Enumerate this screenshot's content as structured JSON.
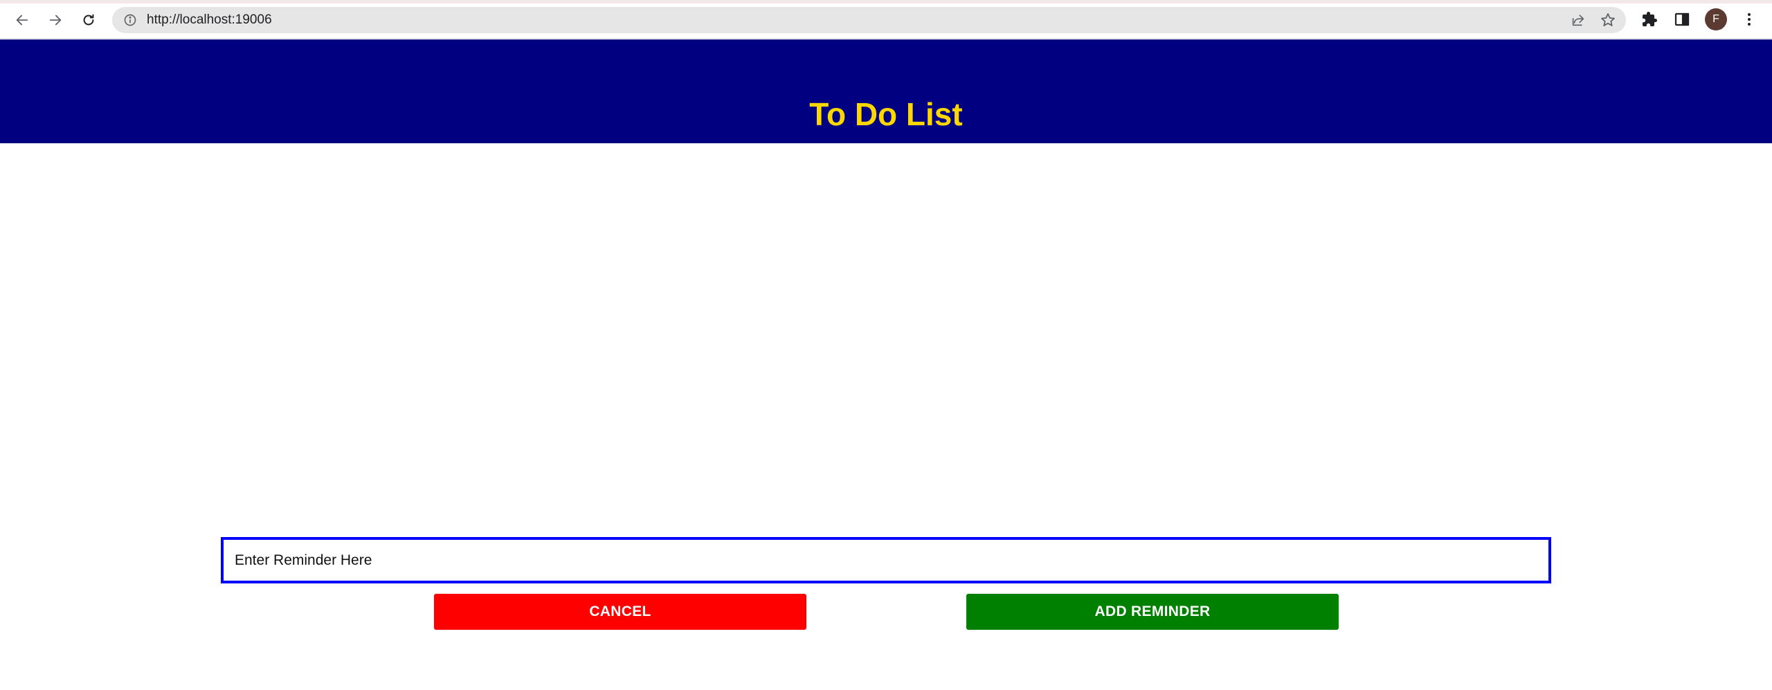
{
  "browser": {
    "url": "http://localhost:19006",
    "avatar_initial": "F",
    "icons": {
      "back": "arrow-left-icon",
      "forward": "arrow-right-icon",
      "reload": "reload-icon",
      "site_info": "info-icon",
      "share": "share-icon",
      "bookmark": "star-icon",
      "extensions": "puzzle-icon",
      "side_panel": "side-panel-icon",
      "menu": "kebab-menu-icon"
    }
  },
  "header": {
    "title": "To Do List",
    "background_color": "#000080",
    "title_color": "#ffd700"
  },
  "form": {
    "reminder_placeholder": "Enter Reminder Here",
    "reminder_value": "",
    "input_border_color": "#0000ff"
  },
  "actions": {
    "cancel_label": "CANCEL",
    "cancel_color": "#ff0000",
    "add_label": "ADD REMINDER",
    "add_color": "#008000"
  }
}
